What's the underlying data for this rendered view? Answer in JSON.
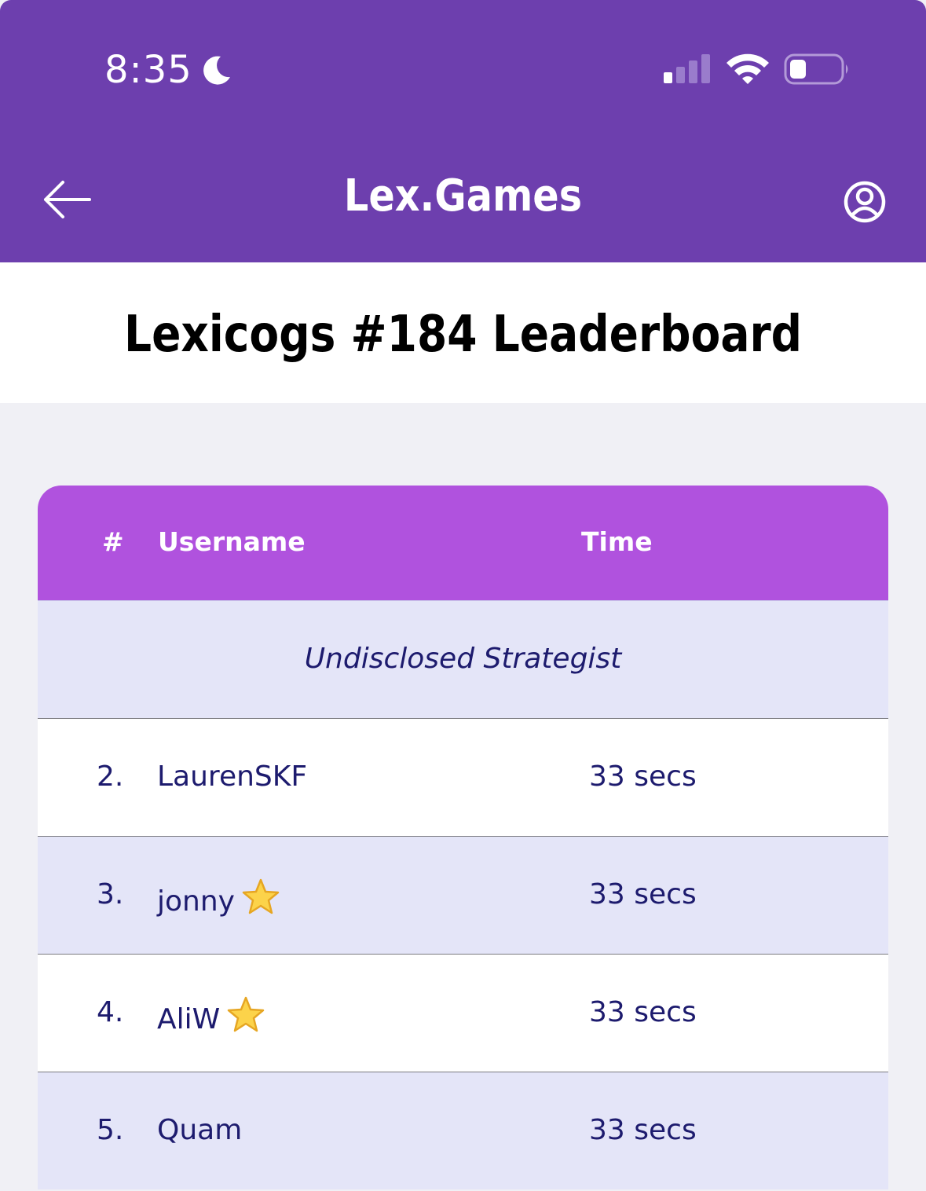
{
  "status_bar": {
    "time": "8:35",
    "moon_icon": "moon-icon",
    "signal_icon": "cellular-signal-icon",
    "wifi_icon": "wifi-icon",
    "battery_icon": "battery-icon"
  },
  "nav": {
    "back_icon": "arrow-left-icon",
    "title": "Lex.Games",
    "profile_icon": "user-circle-icon"
  },
  "page": {
    "title": "Lexicogs #184 Leaderboard"
  },
  "leaderboard": {
    "headers": {
      "rank": "#",
      "username": "Username",
      "time": "Time"
    },
    "hidden_entry": "Undisclosed Strategist",
    "rows": [
      {
        "rank": "2.",
        "username": "LaurenSKF",
        "time": "33 secs",
        "star": false
      },
      {
        "rank": "3.",
        "username": "jonny",
        "time": "33 secs",
        "star": true
      },
      {
        "rank": "4.",
        "username": "AliW",
        "time": "33 secs",
        "star": true
      },
      {
        "rank": "5.",
        "username": "Quam",
        "time": "33 secs",
        "star": false
      }
    ]
  },
  "colors": {
    "header_bg": "#6d3fae",
    "table_header_bg": "#b052de",
    "row_alt_bg": "#e4e5f8",
    "text": "#1d1b6e",
    "page_bg": "#f0f0f5"
  }
}
